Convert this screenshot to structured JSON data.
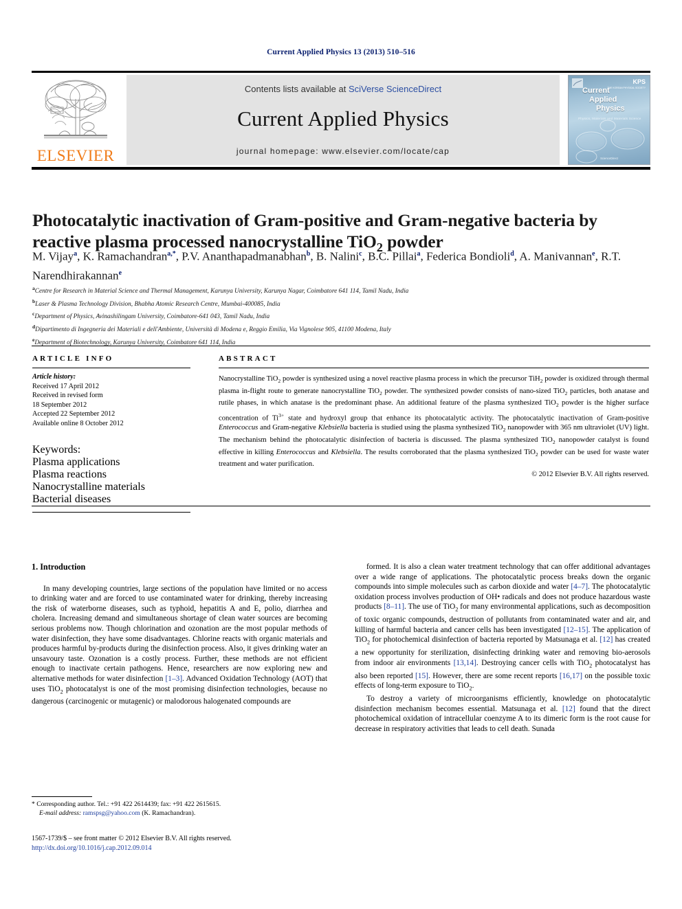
{
  "running_head": "Current Applied Physics 13 (2013) 510–516",
  "masthead": {
    "contents_prefix": "Contents lists available at ",
    "sciencedirect": "SciVerse ScienceDirect",
    "journal_name": "Current Applied Physics",
    "homepage": "journal homepage: www.elsevier.com/locate/cap",
    "publisher_logo_text": "ELSEVIER",
    "publisher_logo_icon": "elsevier-tree-icon",
    "cover": {
      "title_line1": "Current",
      "title_line2": "Applied",
      "title_line3": "Physics",
      "subtitle": "Physics, Materials and Materials Science",
      "society_mark": "KPS",
      "society_sub": "THE KOREAN PHYSICAL SOCIETY",
      "footer": "ScienceDirect"
    }
  },
  "article": {
    "title": "Photocatalytic inactivation of Gram-positive and Gram-negative bacteria by reactive plasma processed nanocrystalline TiO2 powder",
    "title_part1": "Photocatalytic inactivation of Gram-positive and Gram-negative bacteria by reactive plasma processed nanocrystalline TiO",
    "title_sub": "2",
    "title_part2": " powder",
    "authors": [
      {
        "name": "M. Vijay",
        "marks": "a"
      },
      {
        "name": "K. Ramachandran",
        "marks": "a,*"
      },
      {
        "name": "P.V. Ananthapadmanabhan",
        "marks": "b"
      },
      {
        "name": "B. Nalini",
        "marks": "c"
      },
      {
        "name": "B.C. Pillai",
        "marks": "a"
      },
      {
        "name": "Federica Bondioli",
        "marks": "d"
      },
      {
        "name": "A. Manivannan",
        "marks": "e"
      },
      {
        "name": "R.T. Narendhirakannan",
        "marks": "e"
      }
    ],
    "affiliations": [
      {
        "mark": "a",
        "text": "Centre for Research in Material Science and Thermal Management, Karunya University, Karunya Nagar, Coimbatore 641 114, Tamil Nadu, India"
      },
      {
        "mark": "b",
        "text": "Laser & Plasma Technology Division, Bhabha Atomic Research Centre, Mumbai-400085, India"
      },
      {
        "mark": "c",
        "text": "Department of Physics, Avinashilingam University, Coimbatore-641 043, Tamil Nadu, India"
      },
      {
        "mark": "d",
        "text": "Dipartimento di Ingegneria dei Materiali e dell'Ambiente, Università di Modena e, Reggio Emilia, Via Vignolese 905, 41100 Modena, Italy"
      },
      {
        "mark": "e",
        "text": "Department of Biotechnology, Karunya University, Coimbatore 641 114, India"
      }
    ]
  },
  "article_info": {
    "heading": "ARTICLE INFO",
    "history_label": "Article history:",
    "history": [
      "Received 17 April 2012",
      "Received in revised form",
      "18 September 2012",
      "Accepted 22 September 2012",
      "Available online 8 October 2012"
    ],
    "keywords_label": "Keywords:",
    "keywords": [
      "Plasma applications",
      "Plasma reactions",
      "Nanocrystalline materials",
      "Bacterial diseases"
    ]
  },
  "abstract": {
    "heading": "ABSTRACT",
    "copyright": "© 2012 Elsevier B.V. All rights reserved."
  },
  "introduction": {
    "heading": "1. Introduction"
  },
  "footnotes": {
    "corresponding": "* Corresponding author. Tel.: +91 422 2614439; fax: +91 422 2615615.",
    "email_label": "E-mail address:",
    "email": "ramspsg@yahoo.com",
    "email_owner": "(K. Ramachandran).",
    "issn_line": "1567-1739/$ – see front matter © 2012 Elsevier B.V. All rights reserved.",
    "doi": "http://dx.doi.org/10.1016/j.cap.2012.09.014"
  },
  "colors": {
    "elsevier_orange": "#f07c1a",
    "link_blue": "#1f3f9e",
    "running_head_blue": "#0a1f6e",
    "band_gray": "#e3e3e3"
  }
}
